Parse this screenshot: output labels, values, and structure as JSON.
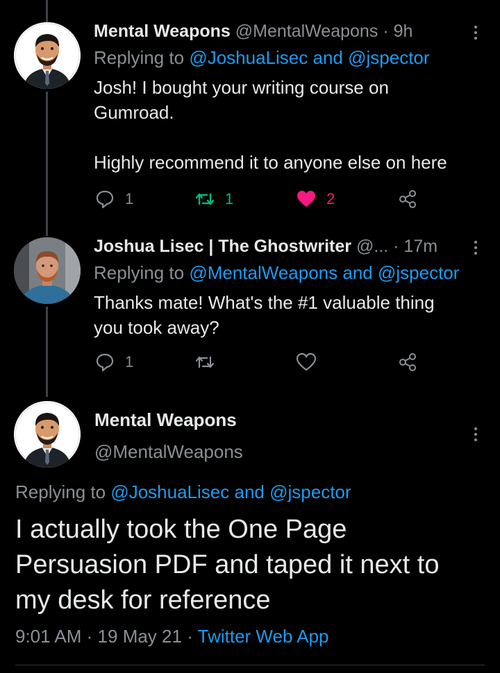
{
  "tweets": [
    {
      "name": "Mental Weapons",
      "handle": "@MentalWeapons",
      "time": "9h",
      "replying_prefix": "Replying to",
      "replying_user1": "@JoshuaLisec",
      "replying_and": "and",
      "replying_user2": "@jspector",
      "text_line1": "Josh!  I bought your writing course on",
      "text_line2": "Gumroad.",
      "text_line3": "Highly recommend it to anyone else on here",
      "reply_count": "1",
      "retweet_count": "1",
      "like_count": "2"
    },
    {
      "name": "Joshua Lisec | The Ghostwriter",
      "handle": "@...",
      "time": "17m",
      "replying_prefix": "Replying to",
      "replying_user1": "@MentalWeapons",
      "replying_and": "and",
      "replying_user2": "@jspector",
      "text_line1": "Thanks mate! What's the #1 valuable thing",
      "text_line2": "you took away?",
      "reply_count": "1"
    }
  ],
  "main_tweet": {
    "name": "Mental Weapons",
    "handle": "@MentalWeapons",
    "replying_prefix": "Replying to",
    "replying_user1": "@JoshuaLisec",
    "replying_and": "and",
    "replying_user2": "@jspector",
    "text_line1": "I actually took the One Page",
    "text_line2": "Persuasion PDF and taped it next to",
    "text_line3": "my desk for reference",
    "time": "9:01 AM",
    "date": "19 May 21",
    "source": "Twitter Web App"
  },
  "colors": {
    "background": "#000000",
    "link": "#1d9bf0",
    "muted": "#8b9096",
    "retweet_active": "#00ba7c",
    "like_active": "#f91880"
  },
  "icons": [
    "reply-icon",
    "retweet-icon",
    "like-icon",
    "share-icon",
    "more-icon"
  ]
}
